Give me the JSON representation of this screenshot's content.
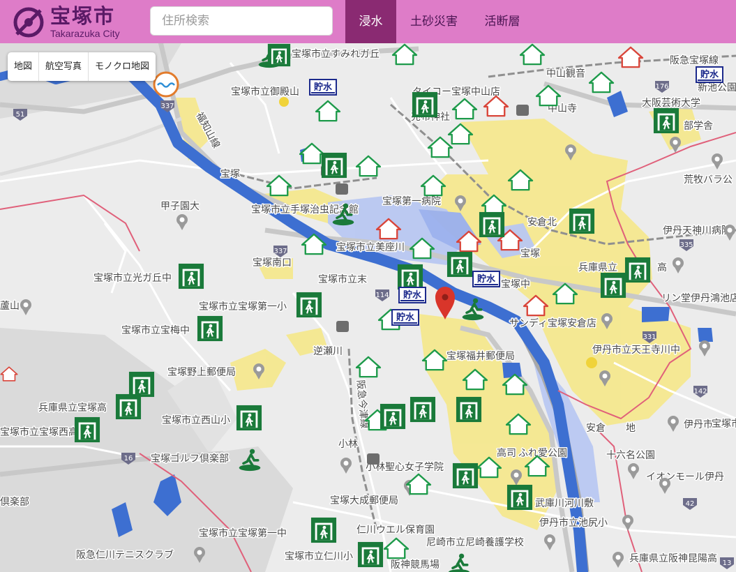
{
  "header": {
    "logo_title": "宝塚市",
    "logo_subtitle": "Takarazuka City",
    "search_placeholder": "住所検索",
    "tabs": [
      {
        "label": "浸水",
        "active": true
      },
      {
        "label": "土砂災害",
        "active": false
      },
      {
        "label": "活断層",
        "active": false
      }
    ]
  },
  "basemap_toggle": {
    "options": [
      "地図",
      "航空写真",
      "モノクロ地図"
    ]
  },
  "map": {
    "place_labels": [
      "宝塚市立すみれガ丘",
      "阪急宝塚線",
      "中山観音",
      "新池公園",
      "宝塚市立御殿山",
      "タイコー宝塚中山店",
      "売布神社",
      "中山寺",
      "大阪芸術大学",
      "部学舎",
      "福知山線",
      "宝塚",
      "荒牧バラ公",
      "甲子園大",
      "宝塚第一病院",
      "安倉北",
      "宝塚市立手塚治虫記念館",
      "伊丹天神川病院",
      "宝塚市立美座川",
      "宝塚南口",
      "宝塚",
      "兵庫県立",
      "高",
      "宝塚市立光ガ丘中",
      "宝塚市立末",
      "宝塚中",
      "リン堂伊丹鴻池店",
      "宝塚市立宝塚第一小",
      "宝塚市立宝梅中",
      "サンディ宝塚安倉店",
      "逆瀬川",
      "宝塚福井郵便局",
      "伊丹市立天王寺川中",
      "宝塚野上郵便局",
      "兵庫県立宝塚高",
      "阪急今津線",
      "安倉",
      "地",
      "宝塚市立西山小",
      "宝塚市立宝塚西高",
      "伊丹市立",
      "小林",
      "小林聖心女子学院",
      "高司",
      "ふれ愛公園",
      "宝塚ゴルフ倶楽部",
      "十六名公園",
      "イオンモール伊丹",
      "倶楽部",
      "宝塚大成郵便局",
      "武庫川河川敷",
      "伊丹市立池尻小",
      "仁川ウエル保育園",
      "宝塚市立宝塚第一中",
      "尼崎市立尼崎養護学校",
      "阪急仁川テニスクラブ",
      "宝塚市立仁川小",
      "阪神競馬場",
      "兵庫県立阪神昆陽高",
      "蘆山",
      "宝塚市立高"
    ],
    "road_numbers": [
      "51",
      "337",
      "176",
      "337",
      "114",
      "335",
      "331",
      "142",
      "16",
      "42",
      "13"
    ],
    "storage_badge": "貯水",
    "icons": {
      "evac_building": "evacuation-shelter-icon",
      "evac_open": "evacuation-area-icon",
      "shelter_house": "shelter-house-icon",
      "pin": "location-pin-icon"
    },
    "colors": {
      "flood_yellow": "#f5e88f",
      "flood_blue": "#b9c8f2",
      "river": "#3d6fd1",
      "boundary": "#e0607a",
      "evac_green": "#1a7a3a",
      "storage_navy": "#1c2a8c",
      "pin_red": "#d9352a"
    }
  }
}
